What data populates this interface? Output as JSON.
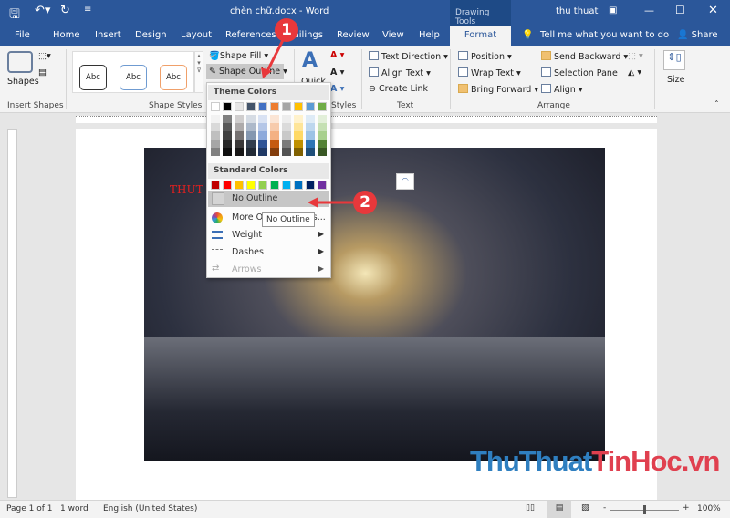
{
  "titlebar": {
    "doc_title": "chèn chữ.docx  -  Word",
    "context_tab": "Drawing Tools",
    "user": "thu thuat"
  },
  "tabs": [
    "File",
    "Home",
    "Insert",
    "Design",
    "Layout",
    "References",
    "Mailings",
    "Review",
    "View",
    "Help",
    "Format"
  ],
  "active_tab": "Format",
  "tell_me": "Tell me what you want to do",
  "share": "Share",
  "ribbon": {
    "insert_shapes": {
      "shapes_label": "Shapes",
      "group": "Insert Shapes"
    },
    "shape_styles": {
      "abc": "Abc",
      "shape_fill": "Shape Fill",
      "shape_outline": "Shape Outline",
      "group": "Shape Styles"
    },
    "wordart": {
      "quick": "Quick",
      "group": "Styles"
    },
    "text": {
      "text_direction": "Text Direction",
      "align_text": "Align Text",
      "create_link": "Create Link",
      "group": "Text"
    },
    "arrange": {
      "position": "Position",
      "wrap_text": "Wrap Text",
      "bring_forward": "Bring Forward",
      "send_backward": "Send Backward",
      "selection_pane": "Selection Pane",
      "align": "Align",
      "group": "Arrange"
    },
    "size": {
      "label": "Size"
    }
  },
  "dropdown": {
    "theme_colors_label": "Theme Colors",
    "theme_colors": [
      "#ffffff",
      "#000000",
      "#e7e6e6",
      "#44546a",
      "#4472c4",
      "#ed7d31",
      "#a5a5a5",
      "#ffc000",
      "#5b9bd5",
      "#70ad47"
    ],
    "theme_shades": [
      [
        "#f2f2f2",
        "#d9d9d9",
        "#bfbfbf",
        "#a6a6a6",
        "#808080"
      ],
      [
        "#808080",
        "#595959",
        "#404040",
        "#262626",
        "#0d0d0d"
      ],
      [
        "#d0cece",
        "#aeabab",
        "#757171",
        "#3a3838",
        "#171616"
      ],
      [
        "#d6dce4",
        "#adb9ca",
        "#8497b0",
        "#333f4f",
        "#222a35"
      ],
      [
        "#d9e2f3",
        "#b4c6e7",
        "#8eaadb",
        "#2f5496",
        "#1f3864"
      ],
      [
        "#fbe5d5",
        "#f7cbac",
        "#f4b183",
        "#c55a11",
        "#833c0b"
      ],
      [
        "#ededed",
        "#dbdbdb",
        "#c9c9c9",
        "#7b7b7b",
        "#525252"
      ],
      [
        "#fff2cc",
        "#fee599",
        "#ffd965",
        "#bf9000",
        "#7f6000"
      ],
      [
        "#deebf6",
        "#bdd7ee",
        "#9cc3e5",
        "#2e75b5",
        "#1e4e79"
      ],
      [
        "#e2efd9",
        "#c5e0b3",
        "#a8d08d",
        "#538135",
        "#375623"
      ]
    ],
    "standard_colors_label": "Standard Colors",
    "standard_colors": [
      "#c00000",
      "#ff0000",
      "#ffc000",
      "#ffff00",
      "#92d050",
      "#00b050",
      "#00b0f0",
      "#0070c0",
      "#002060",
      "#7030a0"
    ],
    "items": {
      "no_outline": "No Outline",
      "more_outline": "More Outline Colors...",
      "weight": "Weight",
      "dashes": "Dashes",
      "arrows": "Arrows"
    },
    "tooltip": "No Outline"
  },
  "document": {
    "red_text": "THUT"
  },
  "callouts": [
    "1",
    "2"
  ],
  "watermark": {
    "part1": "ThuThuat",
    "part2": "TinHoc",
    "part3": ".vn"
  },
  "status": {
    "page": "Page 1 of 1",
    "words": "1 word",
    "language": "English (United States)",
    "zoom": "100%",
    "zoom_minus": "-",
    "zoom_plus": "+"
  },
  "colors": {
    "accent": "#2b579a",
    "callout": "#e8383b"
  }
}
